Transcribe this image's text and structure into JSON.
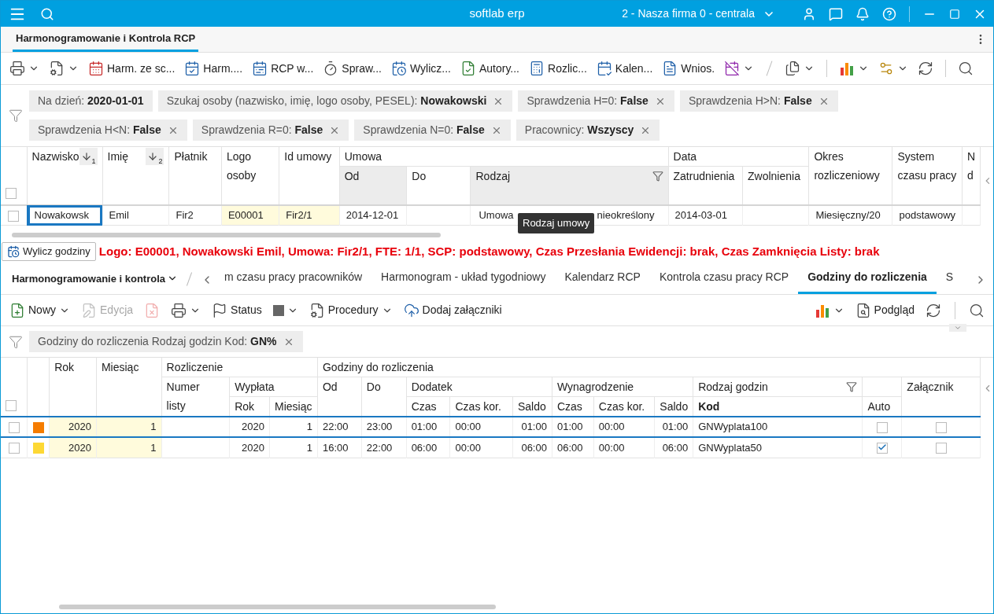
{
  "app_bar": {
    "title": "softlab erp",
    "company": "2 - Nasza firma 0 - centrala"
  },
  "document_tab": {
    "label": "Harmonogramowanie i Kontrola RCP",
    "selected": true
  },
  "toolbar": [
    {
      "kind": "icon",
      "dropdown": true
    },
    {
      "kind": "icon",
      "dropdown": true
    },
    {
      "kind": "button",
      "label": "Harm. ze sc..."
    },
    {
      "kind": "button",
      "label": "Harm...."
    },
    {
      "kind": "button",
      "label": "RCP w..."
    },
    {
      "kind": "button",
      "label": "Spraw..."
    },
    {
      "kind": "button",
      "label": "Wylicz..."
    },
    {
      "kind": "button",
      "label": "Autory..."
    },
    {
      "kind": "button",
      "label": "Rozlic..."
    },
    {
      "kind": "button",
      "label": "Kalen..."
    },
    {
      "kind": "button",
      "label": "Wnios."
    },
    {
      "kind": "icon",
      "dropdown": true
    },
    {
      "kind": "slash"
    },
    {
      "kind": "icon",
      "dropdown": true
    },
    {
      "kind": "divider"
    },
    {
      "kind": "icon",
      "dropdown": true
    },
    {
      "kind": "icon",
      "dropdown": true
    },
    {
      "kind": "icon",
      "dropdown": false
    },
    {
      "kind": "divider"
    },
    {
      "kind": "icon",
      "dropdown": false
    }
  ],
  "filters": [
    {
      "text": "Na dzień: **2020-01-01**",
      "removable": false
    },
    {
      "text": "Szukaj osoby (nazwisko, imię, logo osoby, PESEL): **Nowakowski**",
      "removable": true
    },
    {
      "text": "Sprawdzenia  H=0: **False**",
      "removable": true
    },
    {
      "text": "Sprawdzenia  H>N: **False**",
      "removable": true
    },
    {
      "text": "Sprawdzenia  H<N: **False**",
      "removable": true
    },
    {
      "text": "Sprawdzenia  R=0: **False**",
      "removable": true
    },
    {
      "text": "Sprawdzenia  N=0: **False**",
      "removable": true
    },
    {
      "text": "Pracownicy: **Wszyscy**",
      "removable": true
    }
  ],
  "upper_grid": {
    "header": [
      [
        {
          "kind": "checkbox",
          "checked": false,
          "rowspan": 2
        },
        {
          "label": "Nazwisko",
          "rowspan": 2,
          "sort": "1"
        },
        {
          "label": "Imię",
          "rowspan": 2,
          "sort": "2"
        },
        {
          "label": "Płatnik",
          "rowspan": 2
        },
        {
          "label": "Logo\nosoby",
          "rowspan": 2
        },
        {
          "label": "Id umowy",
          "rowspan": 2
        },
        {
          "label": "Umowa",
          "colspan": 3
        },
        {
          "label": "Data",
          "colspan": 2
        },
        {
          "label": "Okres\nrozliczeniowy",
          "rowspan": 2
        },
        {
          "label": "System\nczasu pracy",
          "rowspan": 2
        },
        {
          "label": "N\nd",
          "rowspan": 2
        }
      ],
      [
        {
          "label": "Od",
          "highlighted": true
        },
        {
          "label": "Do",
          "highlighted": false
        },
        {
          "label": "Rodzaj",
          "highlighted": true,
          "filter": true
        },
        {
          "label": "Zatrudnienia",
          "highlighted": false
        },
        {
          "label": "Zwolnienia",
          "highlighted": false
        }
      ]
    ],
    "rows": [
      {
        "cells": [
          {
            "kind": "checkbox",
            "checked": false
          },
          {
            "kind": "text",
            "value": "Nowakowsk",
            "focused": true
          },
          {
            "kind": "text",
            "value": "Emil",
            "focused": false
          },
          {
            "kind": "text",
            "value": "Fir2",
            "focused": false
          },
          {
            "kind": "text",
            "value": "E00001",
            "focused": false
          },
          {
            "kind": "text",
            "value": "Fir2/1",
            "focused": false
          },
          {
            "kind": "text",
            "value": "2014-12-01",
            "focused": false
          },
          {
            "kind": "empty"
          },
          {
            "kind": "text",
            "parts": [
              "Umowa",
              "nieokreślony"
            ],
            "focused": false
          },
          {
            "kind": "text",
            "value": "2014-03-01",
            "focused": false
          },
          {
            "kind": "empty"
          },
          {
            "kind": "text",
            "value": "Miesięczny/20",
            "focused": false
          },
          {
            "kind": "text",
            "value": "podstawowy",
            "focused": false
          },
          {
            "kind": "empty"
          }
        ]
      }
    ],
    "tooltip": "Rodzaj umowy"
  },
  "action_button": "Wylicz godziny",
  "info_line": "Logo: E00001, Nowakowski Emil, Umowa: Fir2/1, FTE: 1/1, SCP: podstawowy, Czas Przesłania Ewidencji: brak, Czas Zamknięcia Listy: brak",
  "tabs": {
    "module": "Harmonogramowanie i kontrola",
    "items": [
      {
        "label": "m czasu pracy pracowników",
        "selected": false
      },
      {
        "label": "Harmonogram - układ tygodniowy",
        "selected": false
      },
      {
        "label": "Kalendarz RCP",
        "selected": false
      },
      {
        "label": "Kontrola czasu pracy RCP",
        "selected": false
      },
      {
        "label": "Godziny do rozliczenia",
        "selected": true
      },
      {
        "label": "S",
        "selected": false
      }
    ]
  },
  "lower_toolbar": [
    {
      "kind": "button",
      "label": "Nowy",
      "dropdown": true,
      "disabled": false
    },
    {
      "kind": "button",
      "label": "Edycja",
      "dropdown": false,
      "disabled": true
    },
    {
      "kind": "icon",
      "dropdown": false,
      "disabled": true
    },
    {
      "kind": "icon",
      "dropdown": true,
      "disabled": false
    },
    {
      "kind": "button",
      "label": "Status",
      "dropdown": false,
      "disabled": false
    },
    {
      "kind": "icon",
      "dropdown": true,
      "disabled": false
    },
    {
      "kind": "button",
      "label": "Procedury",
      "dropdown": true,
      "disabled": false
    },
    {
      "kind": "button",
      "label": "Dodaj załączniki",
      "dropdown": false,
      "disabled": false
    },
    {
      "kind": "spacer"
    },
    {
      "kind": "icon",
      "dropdown": true,
      "disabled": false
    },
    {
      "kind": "button",
      "label": "Podgląd",
      "dropdown": false,
      "disabled": false
    },
    {
      "kind": "icon",
      "dropdown": false,
      "disabled": false
    },
    {
      "kind": "divider"
    },
    {
      "kind": "icon",
      "dropdown": false,
      "disabled": false
    }
  ],
  "lower_filters": [
    {
      "text": "Godziny do rozliczenia Rodzaj godzin Kod: **GN%**",
      "removable": true
    }
  ],
  "lower_grid": {
    "header": [
      [
        {
          "kind": "checkbox",
          "checked": false,
          "rowspan": 3
        },
        {
          "kind": "blank",
          "rowspan": 3
        },
        {
          "label": "Rok",
          "rowspan": 3
        },
        {
          "label": "Miesiąc",
          "rowspan": 3
        },
        {
          "label": "Rozliczenie",
          "colspan": 3
        },
        {
          "label": "Godziny do rozliczenia",
          "colspan": 11
        }
      ],
      [
        {
          "label": "Numer\nlisty",
          "rowspan": 2
        },
        {
          "label": "Wypłata",
          "colspan": 2
        },
        {
          "label": "Od",
          "rowspan": 2
        },
        {
          "label": "Do",
          "rowspan": 2
        },
        {
          "label": "Dodatek",
          "colspan": 3
        },
        {
          "label": "Wynagrodzenie",
          "colspan": 3
        },
        {
          "label": "Rodzaj godzin",
          "filter": true
        },
        {
          "kind": "blank"
        },
        {
          "label": "Załącznik",
          "rowspan": 2
        }
      ],
      [
        {
          "label": "Rok"
        },
        {
          "label": "Miesiąc"
        },
        {
          "label": "Czas"
        },
        {
          "label": "Czas kor."
        },
        {
          "label": "Saldo"
        },
        {
          "label": "Czas"
        },
        {
          "label": "Czas kor."
        },
        {
          "label": "Saldo"
        },
        {
          "label": "Kod",
          "bold": true
        },
        {
          "label": "Auto"
        }
      ]
    ],
    "rows": [
      {
        "selected": true,
        "cells": [
          {
            "kind": "checkbox",
            "checked": false
          },
          {
            "kind": "swatch",
            "color": "#f57c00"
          },
          "2020",
          "1",
          "",
          "2020",
          "1",
          "22:00",
          "23:00",
          "01:00",
          "00:00",
          "01:00",
          "01:00",
          "00:00",
          "01:00",
          "GNWyplata100",
          {
            "kind": "checkbox",
            "checked": false
          },
          {
            "kind": "checkbox",
            "checked": false
          }
        ]
      },
      {
        "selected": false,
        "cells": [
          {
            "kind": "checkbox",
            "checked": false
          },
          {
            "kind": "swatch",
            "color": "#fdd835"
          },
          "2020",
          "1",
          "",
          "2020",
          "1",
          "16:00",
          "22:00",
          "06:00",
          "00:00",
          "06:00",
          "06:00",
          "00:00",
          "06:00",
          "GNWyplata50",
          {
            "kind": "checkbox",
            "checked": true
          },
          {
            "kind": "checkbox",
            "checked": false
          }
        ]
      }
    ]
  }
}
